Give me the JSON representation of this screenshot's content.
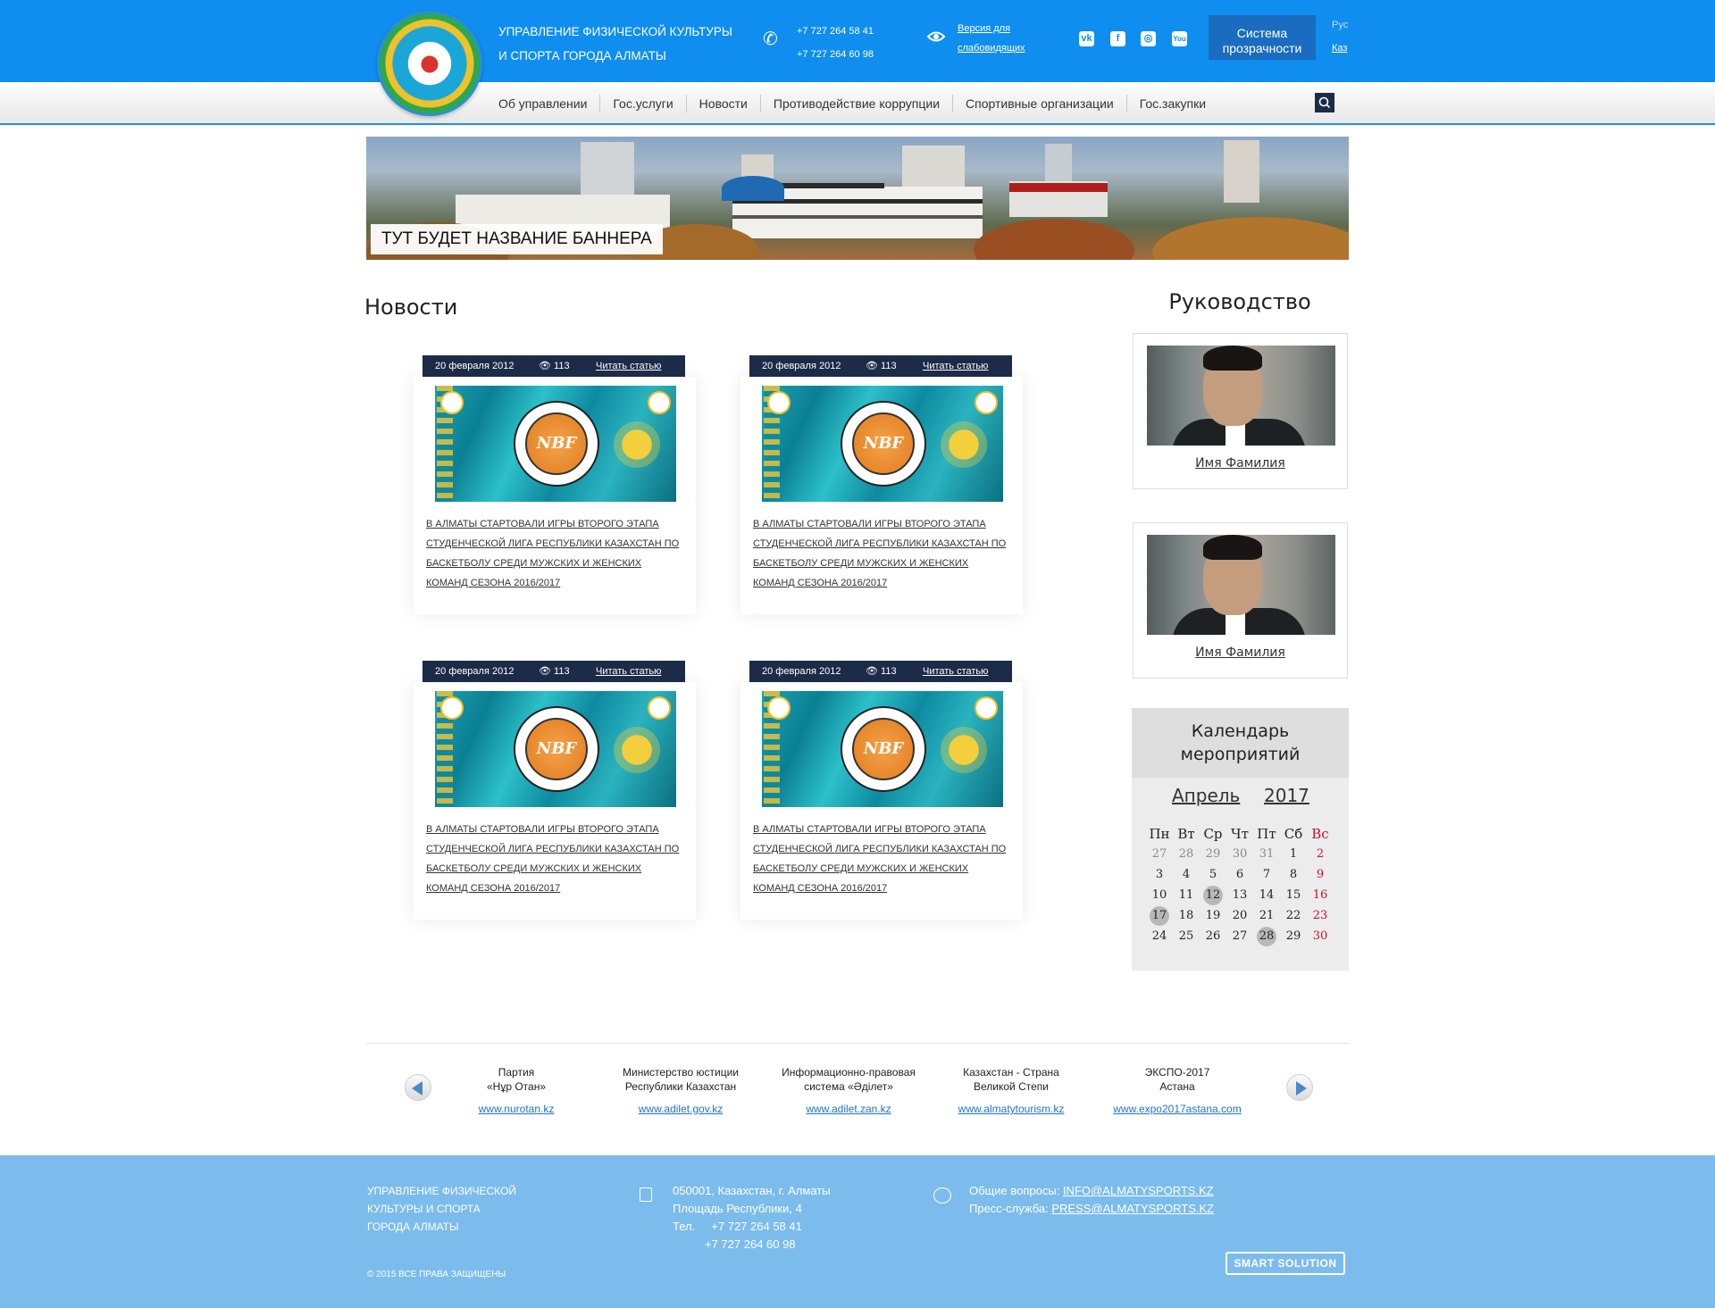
{
  "header": {
    "org_title_line1": "Управление физической культуры",
    "org_title_line2": "и спорта города Алматы",
    "phone1": "+7 727 264 58 41",
    "phone2": "+7 727 264 60 98",
    "vision_line1": "Версия для",
    "vision_line2": "слабовидящих",
    "social_icons": [
      "vk-icon",
      "facebook-icon",
      "instagram-icon",
      "youtube-icon"
    ],
    "social_glyphs": [
      "vk",
      "f",
      "◎",
      "You"
    ],
    "transparency_line1": "Система",
    "transparency_line2": "прозрачности",
    "lang_ru": "Рус",
    "lang_kz": "Каз",
    "brand_color": "#0f8ef0"
  },
  "nav": {
    "items": [
      "Об управлении",
      "Гос.услуги",
      "Новости",
      "Противодействие коррупции",
      "Спортивные организации",
      "Гос.закупки"
    ]
  },
  "banner": {
    "caption": "Тут будет название баннера"
  },
  "news": {
    "heading": "Новости",
    "cards": [
      {
        "date": "20 февраля 2012",
        "views": "113",
        "read": "Читать статью",
        "logo_text": "NBF",
        "title": "В Алматы стартовали игры второго этапа студенческой лига Республики Казахстан по баскетболу среди мужских и женских команд сезона 2016/2017"
      },
      {
        "date": "20 февраля 2012",
        "views": "113",
        "read": "Читать статью",
        "logo_text": "NBF",
        "title": "В Алматы стартовали игры второго этапа студенческой лига Республики Казахстан по баскетболу среди мужских и женских команд сезона 2016/2017"
      },
      {
        "date": "20 февраля 2012",
        "views": "113",
        "read": "Читать статью",
        "logo_text": "NBF",
        "title": "В Алматы стартовали игры второго этапа студенческой лига Республики Казахстан по баскетболу среди мужских и женских команд сезона 2016/2017"
      },
      {
        "date": "20 февраля 2012",
        "views": "113",
        "read": "Читать статью",
        "logo_text": "NBF",
        "title": "В Алматы стартовали игры второго этапа студенческой лига Республики Казахстан по баскетболу среди мужских и женских команд сезона 2016/2017"
      }
    ]
  },
  "leadership": {
    "heading": "Руководство",
    "people": [
      {
        "name": "Имя Фамилия"
      },
      {
        "name": "Имя Фамилия"
      }
    ]
  },
  "calendar": {
    "title_line1": "Календарь",
    "title_line2": "мероприятий",
    "month": "Апрель",
    "year": "2017",
    "weekdays": [
      "Пн",
      "Вт",
      "Ср",
      "Чт",
      "Пт",
      "Сб",
      "Вс"
    ],
    "weeks": [
      [
        "27",
        "28",
        "29",
        "30",
        "31",
        "1",
        "2"
      ],
      [
        "3",
        "4",
        "5",
        "6",
        "7",
        "8",
        "9"
      ],
      [
        "10",
        "11",
        "12",
        "13",
        "14",
        "15",
        "16"
      ],
      [
        "17",
        "18",
        "19",
        "20",
        "21",
        "22",
        "23"
      ],
      [
        "24",
        "25",
        "26",
        "27",
        "28",
        "29",
        "30"
      ]
    ],
    "other_month_days": [
      "27",
      "28",
      "29",
      "30",
      "31"
    ],
    "highlighted_days": [
      "12",
      "17",
      "28"
    ],
    "sunday_color": "#c8102e"
  },
  "partners": [
    {
      "name_line1": "Партия",
      "name_line2": "«Нұр Отан»",
      "url": "www.nurotan.kz"
    },
    {
      "name_line1": "Министерство юстиции",
      "name_line2": "Республики Казахстан",
      "url": "www.adilet.gov.kz"
    },
    {
      "name_line1": "Информационно-правовая",
      "name_line2": "система «Әділет»",
      "url": "www.adilet.zan.kz"
    },
    {
      "name_line1": "Казахстан - Страна",
      "name_line2": "Великой Степи",
      "url": "www.almatytourism.kz"
    },
    {
      "name_line1": "ЭКСПО-2017",
      "name_line2": "Астана",
      "url": "www.expo2017astana.com"
    }
  ],
  "footer": {
    "org_line1": "Управление физической",
    "org_line2": "культуры и спорта",
    "org_line3": "города Алматы",
    "copyright": "© 2015 ВСЕ ПРАВА ЗАЩИЩЕНЫ",
    "address_line1": "050001, Казахстан, г. Алматы",
    "address_line2": "Площадь Республики, 4",
    "phone_label": "Тел.",
    "phone1": "+7 727 264 58 41",
    "phone2": "+7 727 264 60 98",
    "general_label": "Общие вопросы:",
    "general_email": "INFO@ALMATYSPORTS.KZ",
    "press_label": "Пресс-служба:",
    "press_email": "PRESS@ALMATYSPORTS.KZ",
    "dev_logo": "SMART SOLUTION",
    "footer_color": "#7cbcec"
  }
}
